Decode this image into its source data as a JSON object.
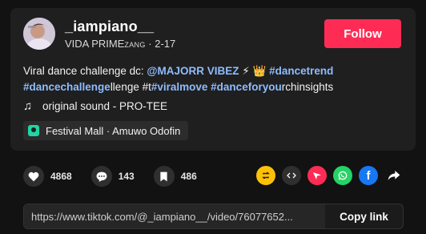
{
  "author": {
    "username": "_iampiano__",
    "display_name_main": "VIDA PRIME",
    "display_name_small": "ZANG",
    "separator": "·",
    "date": "2-17"
  },
  "follow_label": "Follow",
  "caption": {
    "intro": "Viral dance challenge dc: ",
    "mention": "@MAJORR VIBEZ",
    "emoji": "⚡ 👑",
    "tag1": "#dancetrend",
    "tag2": "#dancechallenge",
    "text2": "llenge #t",
    "tag3": "#viralmove",
    "tag4": "#danceforyou",
    "text4": "rchinsights"
  },
  "sound": {
    "icon": "music-note-icon",
    "label": "original sound - PRO-TEE"
  },
  "location": {
    "icon": "location-pin-icon",
    "label": "Festival Mall · Amuwo Odofin"
  },
  "stats": {
    "likes": "4868",
    "comments": "143",
    "saves": "486"
  },
  "share_icons": [
    "repost-icon",
    "embed-icon",
    "send-icon",
    "whatsapp-icon",
    "facebook-icon",
    "share-arrow-icon"
  ],
  "colors": {
    "accent": "#fe2c55",
    "hashtag": "#8fbcff",
    "location_green": "#20d5a3",
    "repost_yellow": "#ffc107",
    "whatsapp_green": "#25d366",
    "facebook_blue": "#1877f2"
  },
  "link": {
    "url": "https://www.tiktok.com/@_iampiano__/video/76077652...",
    "copy_label": "Copy link"
  }
}
